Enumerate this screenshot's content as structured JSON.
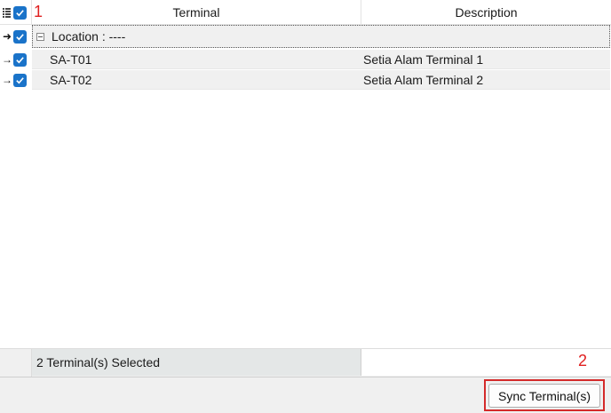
{
  "header": {
    "col_terminal": "Terminal",
    "col_description": "Description",
    "annotation_1": "1",
    "select_all_checked": true
  },
  "group": {
    "label": "Location : ----",
    "expanded": true,
    "checked": true
  },
  "rows": [
    {
      "terminal": "SA-T01",
      "description": "Setia Alam Terminal 1",
      "checked": true
    },
    {
      "terminal": "SA-T02",
      "description": "Setia Alam Terminal 2",
      "checked": true
    }
  ],
  "footer": {
    "summary": "2 Terminal(s) Selected",
    "annotation_2": "2",
    "sync_button": "Sync Terminal(s)"
  },
  "colors": {
    "checkbox": "#1a73c9",
    "highlight": "#d42a2a",
    "row_bg": "#f0f0f0"
  },
  "icons": {
    "column_chooser": "list-lines-icon",
    "row_indicator": "arrow-right-icon",
    "collapse": "minus-box-icon",
    "check": "checkmark-icon"
  }
}
